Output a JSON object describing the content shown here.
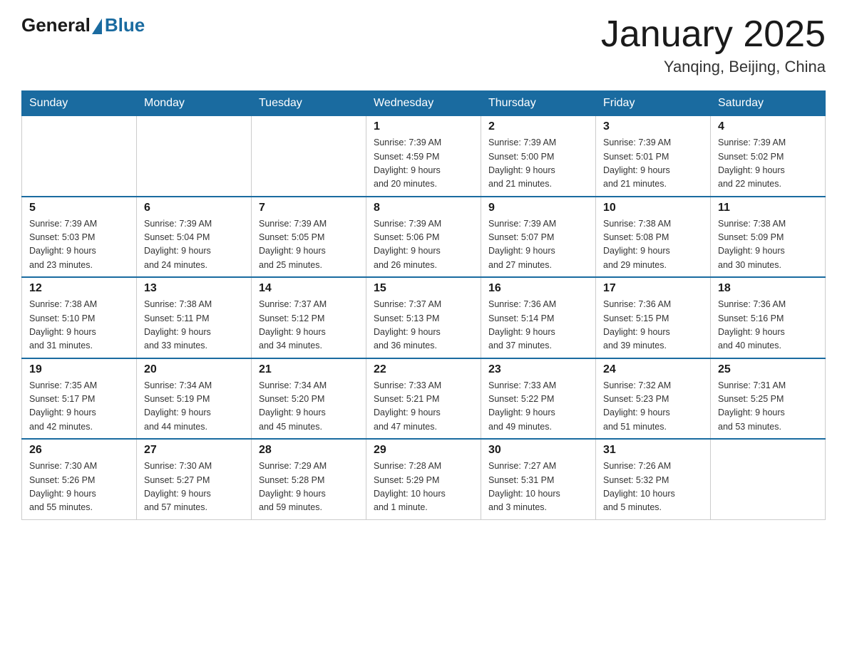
{
  "header": {
    "logo_general": "General",
    "logo_blue": "Blue",
    "month_title": "January 2025",
    "location": "Yanqing, Beijing, China"
  },
  "calendar": {
    "days_of_week": [
      "Sunday",
      "Monday",
      "Tuesday",
      "Wednesday",
      "Thursday",
      "Friday",
      "Saturday"
    ],
    "weeks": [
      [
        {
          "day": "",
          "info": ""
        },
        {
          "day": "",
          "info": ""
        },
        {
          "day": "",
          "info": ""
        },
        {
          "day": "1",
          "info": "Sunrise: 7:39 AM\nSunset: 4:59 PM\nDaylight: 9 hours\nand 20 minutes."
        },
        {
          "day": "2",
          "info": "Sunrise: 7:39 AM\nSunset: 5:00 PM\nDaylight: 9 hours\nand 21 minutes."
        },
        {
          "day": "3",
          "info": "Sunrise: 7:39 AM\nSunset: 5:01 PM\nDaylight: 9 hours\nand 21 minutes."
        },
        {
          "day": "4",
          "info": "Sunrise: 7:39 AM\nSunset: 5:02 PM\nDaylight: 9 hours\nand 22 minutes."
        }
      ],
      [
        {
          "day": "5",
          "info": "Sunrise: 7:39 AM\nSunset: 5:03 PM\nDaylight: 9 hours\nand 23 minutes."
        },
        {
          "day": "6",
          "info": "Sunrise: 7:39 AM\nSunset: 5:04 PM\nDaylight: 9 hours\nand 24 minutes."
        },
        {
          "day": "7",
          "info": "Sunrise: 7:39 AM\nSunset: 5:05 PM\nDaylight: 9 hours\nand 25 minutes."
        },
        {
          "day": "8",
          "info": "Sunrise: 7:39 AM\nSunset: 5:06 PM\nDaylight: 9 hours\nand 26 minutes."
        },
        {
          "day": "9",
          "info": "Sunrise: 7:39 AM\nSunset: 5:07 PM\nDaylight: 9 hours\nand 27 minutes."
        },
        {
          "day": "10",
          "info": "Sunrise: 7:38 AM\nSunset: 5:08 PM\nDaylight: 9 hours\nand 29 minutes."
        },
        {
          "day": "11",
          "info": "Sunrise: 7:38 AM\nSunset: 5:09 PM\nDaylight: 9 hours\nand 30 minutes."
        }
      ],
      [
        {
          "day": "12",
          "info": "Sunrise: 7:38 AM\nSunset: 5:10 PM\nDaylight: 9 hours\nand 31 minutes."
        },
        {
          "day": "13",
          "info": "Sunrise: 7:38 AM\nSunset: 5:11 PM\nDaylight: 9 hours\nand 33 minutes."
        },
        {
          "day": "14",
          "info": "Sunrise: 7:37 AM\nSunset: 5:12 PM\nDaylight: 9 hours\nand 34 minutes."
        },
        {
          "day": "15",
          "info": "Sunrise: 7:37 AM\nSunset: 5:13 PM\nDaylight: 9 hours\nand 36 minutes."
        },
        {
          "day": "16",
          "info": "Sunrise: 7:36 AM\nSunset: 5:14 PM\nDaylight: 9 hours\nand 37 minutes."
        },
        {
          "day": "17",
          "info": "Sunrise: 7:36 AM\nSunset: 5:15 PM\nDaylight: 9 hours\nand 39 minutes."
        },
        {
          "day": "18",
          "info": "Sunrise: 7:36 AM\nSunset: 5:16 PM\nDaylight: 9 hours\nand 40 minutes."
        }
      ],
      [
        {
          "day": "19",
          "info": "Sunrise: 7:35 AM\nSunset: 5:17 PM\nDaylight: 9 hours\nand 42 minutes."
        },
        {
          "day": "20",
          "info": "Sunrise: 7:34 AM\nSunset: 5:19 PM\nDaylight: 9 hours\nand 44 minutes."
        },
        {
          "day": "21",
          "info": "Sunrise: 7:34 AM\nSunset: 5:20 PM\nDaylight: 9 hours\nand 45 minutes."
        },
        {
          "day": "22",
          "info": "Sunrise: 7:33 AM\nSunset: 5:21 PM\nDaylight: 9 hours\nand 47 minutes."
        },
        {
          "day": "23",
          "info": "Sunrise: 7:33 AM\nSunset: 5:22 PM\nDaylight: 9 hours\nand 49 minutes."
        },
        {
          "day": "24",
          "info": "Sunrise: 7:32 AM\nSunset: 5:23 PM\nDaylight: 9 hours\nand 51 minutes."
        },
        {
          "day": "25",
          "info": "Sunrise: 7:31 AM\nSunset: 5:25 PM\nDaylight: 9 hours\nand 53 minutes."
        }
      ],
      [
        {
          "day": "26",
          "info": "Sunrise: 7:30 AM\nSunset: 5:26 PM\nDaylight: 9 hours\nand 55 minutes."
        },
        {
          "day": "27",
          "info": "Sunrise: 7:30 AM\nSunset: 5:27 PM\nDaylight: 9 hours\nand 57 minutes."
        },
        {
          "day": "28",
          "info": "Sunrise: 7:29 AM\nSunset: 5:28 PM\nDaylight: 9 hours\nand 59 minutes."
        },
        {
          "day": "29",
          "info": "Sunrise: 7:28 AM\nSunset: 5:29 PM\nDaylight: 10 hours\nand 1 minute."
        },
        {
          "day": "30",
          "info": "Sunrise: 7:27 AM\nSunset: 5:31 PM\nDaylight: 10 hours\nand 3 minutes."
        },
        {
          "day": "31",
          "info": "Sunrise: 7:26 AM\nSunset: 5:32 PM\nDaylight: 10 hours\nand 5 minutes."
        },
        {
          "day": "",
          "info": ""
        }
      ]
    ]
  }
}
